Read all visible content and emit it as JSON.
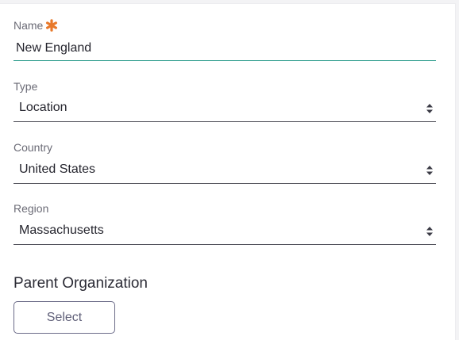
{
  "form": {
    "name": {
      "label": "Name",
      "value": "New England",
      "required": true,
      "required_icon": "asterisk-icon",
      "required_color": "#e8792b"
    },
    "type": {
      "label": "Type",
      "value": "Location",
      "icon": "sort-icon"
    },
    "country": {
      "label": "Country",
      "value": "United States",
      "icon": "sort-icon"
    },
    "region": {
      "label": "Region",
      "value": "Massachusetts",
      "icon": "sort-icon"
    },
    "parent_organization": {
      "heading": "Parent Organization",
      "button_label": "Select"
    }
  },
  "colors": {
    "active_underline": "#2c9c8c",
    "underline": "#55555e",
    "button_border": "#6b6b88"
  }
}
